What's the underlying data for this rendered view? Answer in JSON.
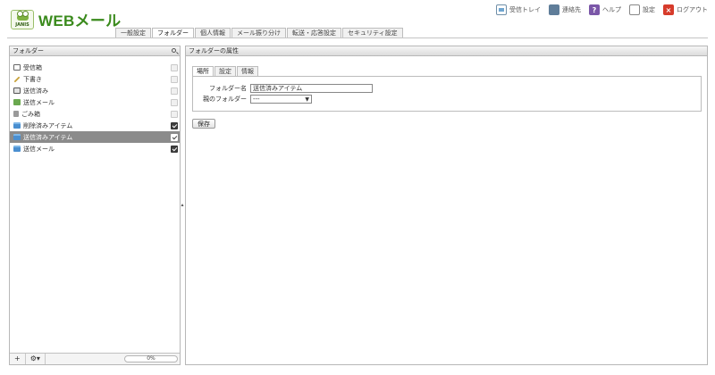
{
  "app": {
    "logo_text": "WEBメール",
    "logo_sub": "JANIS"
  },
  "topnav": [
    {
      "label": "受信トレイ",
      "icon": "inbox-icon"
    },
    {
      "label": "連絡先",
      "icon": "address-book-icon"
    },
    {
      "label": "ヘルプ",
      "icon": "help-icon",
      "glyph": "?"
    },
    {
      "label": "設定",
      "icon": "settings-icon"
    },
    {
      "label": "ログアウト",
      "icon": "logout-icon",
      "glyph": "×"
    }
  ],
  "tabs": [
    {
      "label": "一般設定"
    },
    {
      "label": "フォルダー",
      "active": true
    },
    {
      "label": "個人情報"
    },
    {
      "label": "メール振り分け"
    },
    {
      "label": "転送・応答設定"
    },
    {
      "label": "セキュリティ設定"
    }
  ],
  "folder_panel": {
    "title": "フォルダー",
    "folders": [
      {
        "label": "受信箱",
        "icon": "inbox-folder-icon",
        "subscribed": false
      },
      {
        "label": "下書き",
        "icon": "draft-pencil-icon",
        "subscribed": false
      },
      {
        "label": "送信済み",
        "icon": "sent-folder-icon",
        "subscribed": false
      },
      {
        "label": "送信メール",
        "icon": "outbox-icon",
        "subscribed": false
      },
      {
        "label": "ごみ箱",
        "icon": "trash-icon",
        "subscribed": false
      },
      {
        "label": "削除済みアイテム",
        "icon": "folder-icon",
        "subscribed": true
      },
      {
        "label": "送信済みアイテム",
        "icon": "folder-icon",
        "subscribed": true,
        "selected": true
      },
      {
        "label": "送信メール",
        "icon": "folder-icon",
        "subscribed": true
      }
    ],
    "footer": {
      "add_label": "+",
      "menu_label": "⚙▾",
      "quota_text": "0%",
      "quota_fraction": 0.0
    }
  },
  "properties_panel": {
    "title": "フォルダーの属性",
    "tabs": [
      {
        "label": "場所",
        "active": true
      },
      {
        "label": "設定"
      },
      {
        "label": "情報"
      }
    ],
    "fields": {
      "name_label": "フォルダー名",
      "name_value": "送信済みアイテム",
      "parent_label": "親のフォルダー",
      "parent_value": "---"
    },
    "save_label": "保存"
  }
}
